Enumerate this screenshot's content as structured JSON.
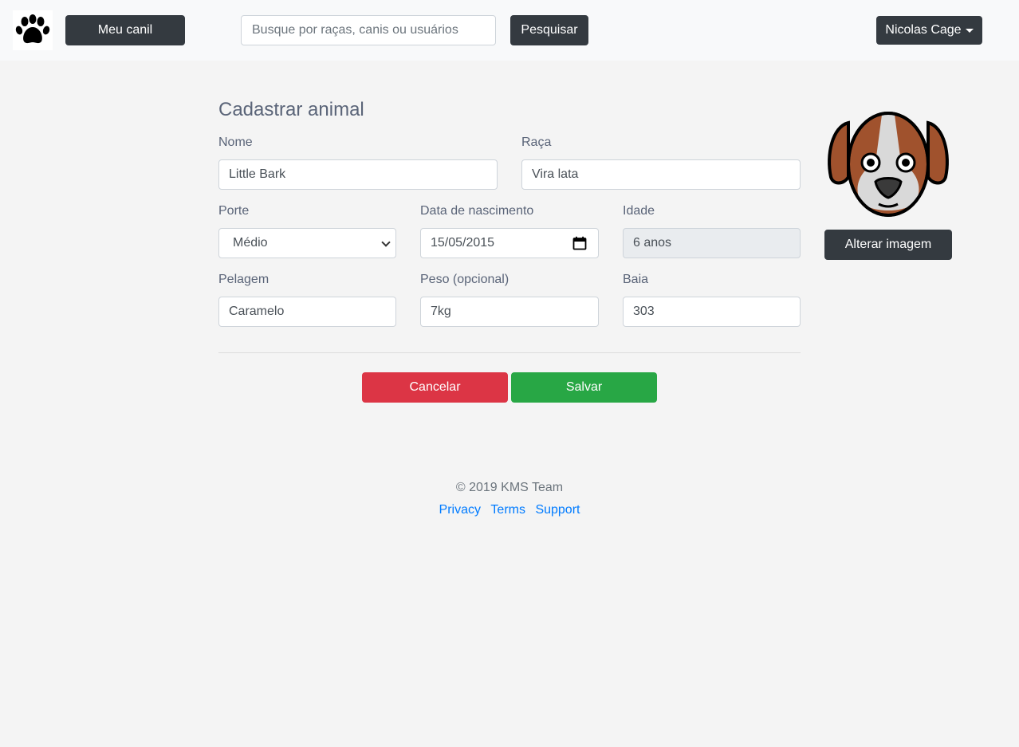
{
  "navbar": {
    "my_kennel_label": "Meu canil",
    "search_placeholder": "Busque por raças, canis ou usuários",
    "search_button_label": "Pesquisar",
    "user_name": "Nicolas Cage"
  },
  "form": {
    "title": "Cadastrar animal",
    "name_label": "Nome",
    "name_value": "Little Bark",
    "breed_label": "Raça",
    "breed_value": "Vira lata",
    "size_label": "Porte",
    "size_value": "Médio",
    "birth_label": "Data de nascimento",
    "birth_value": "15/05/2015",
    "age_label": "Idade",
    "age_value": "6 anos",
    "coat_label": "Pelagem",
    "coat_value": "Caramelo",
    "weight_label": "Peso (opcional)",
    "weight_value": "7kg",
    "stall_label": "Baia",
    "stall_value": "303",
    "cancel_label": "Cancelar",
    "save_label": "Salvar",
    "change_image_label": "Alterar imagem"
  },
  "footer": {
    "copyright": "© 2019 KMS Team",
    "links": [
      "Privacy",
      "Terms",
      "Support"
    ]
  },
  "colors": {
    "dark_button": "#343a40",
    "cancel": "#dc3545",
    "save": "#28a745",
    "link": "#007bff"
  }
}
